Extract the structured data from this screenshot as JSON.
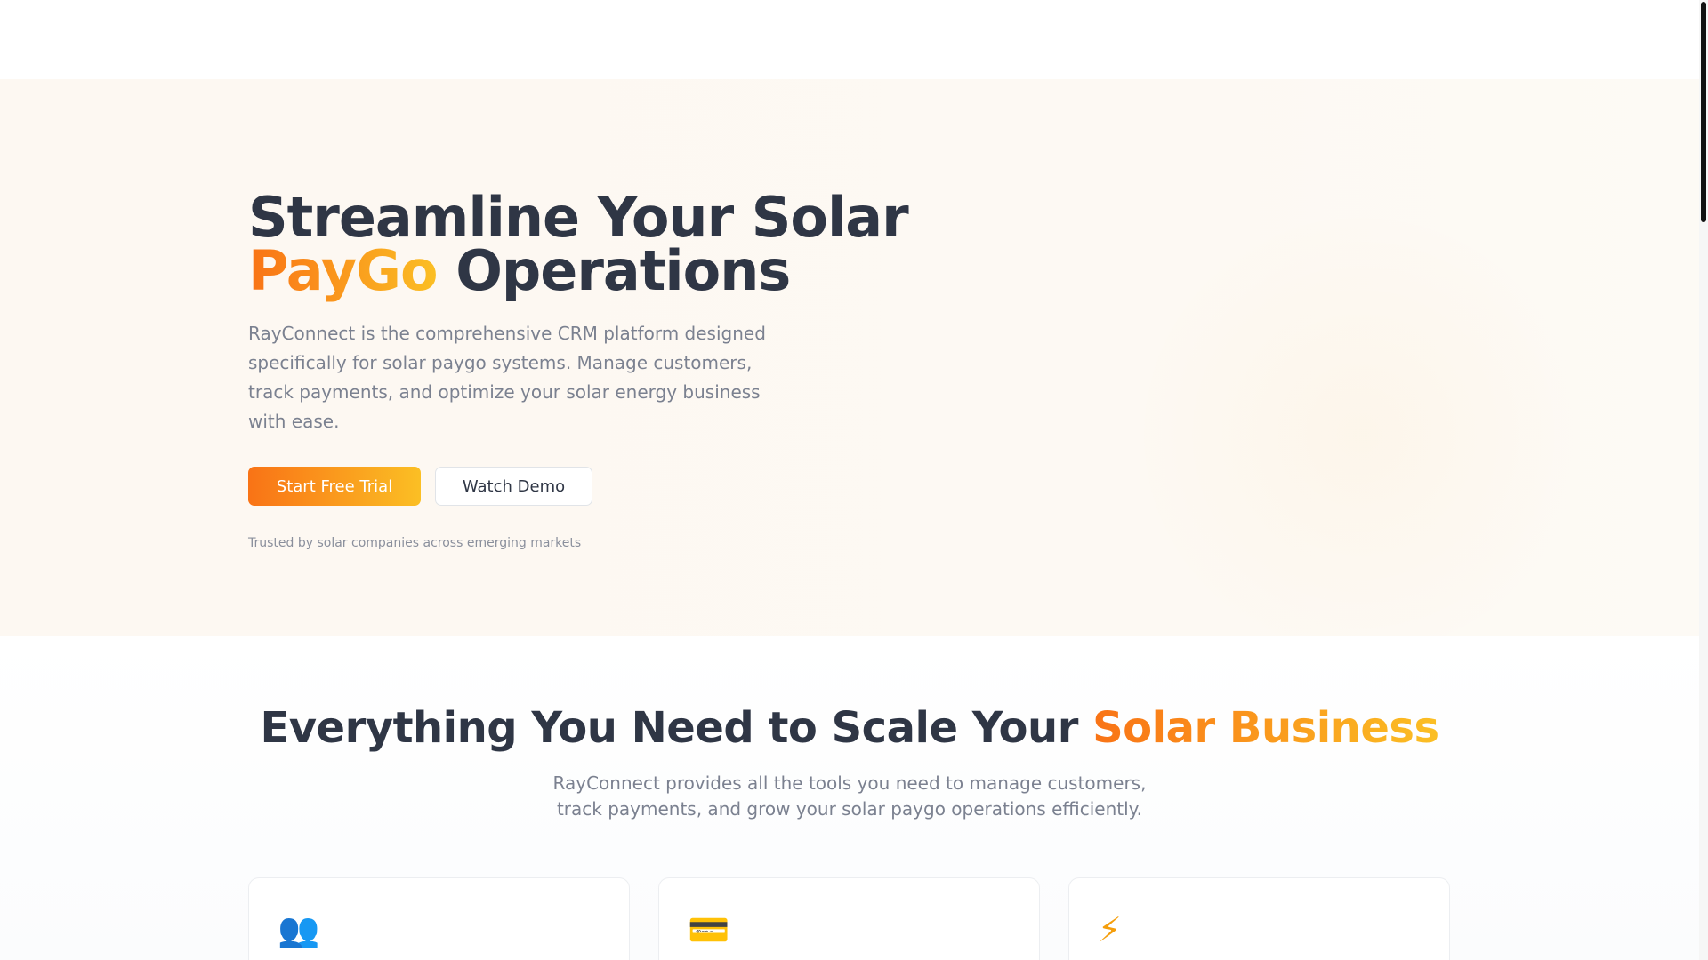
{
  "hero": {
    "title_line1": "Streamline Your Solar",
    "title_accent": "PayGo",
    "title_rest": " Operations",
    "subtitle": "RayConnect is the comprehensive CRM platform designed specifically for solar paygo systems. Manage customers, track payments, and optimize your solar energy business with ease.",
    "primary_cta": "Start Free Trial",
    "secondary_cta": "Watch Demo",
    "trusted_text": "Trusted by solar companies across emerging markets"
  },
  "features": {
    "title_main": "Everything You Need to Scale Your ",
    "title_accent": "Solar Business",
    "subtitle": "RayConnect provides all the tools you need to manage customers, track payments, and grow your solar paygo operations efficiently.",
    "cards": [
      {
        "icon": "users-icon",
        "glyph": "👥"
      },
      {
        "icon": "credit-card-icon",
        "glyph": "💳"
      },
      {
        "icon": "lightning-bolt-icon",
        "glyph": "⚡"
      }
    ]
  },
  "colors": {
    "accent_start": "#f97316",
    "accent_end": "#fbbf24",
    "heading": "#2f3645",
    "body_text": "#7b8190",
    "hero_bg": "#fdf8f2"
  }
}
